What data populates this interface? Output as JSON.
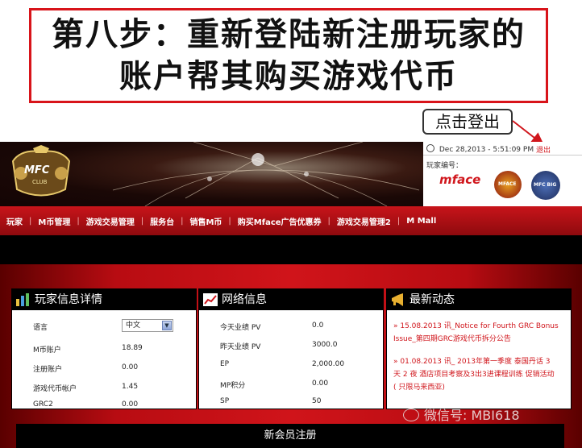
{
  "instruction": {
    "line1": "第八步：重新登陆新注册玩家的",
    "line2": "账户帮其购买游戏代币",
    "callout": "点击登出"
  },
  "site": {
    "logo": {
      "main": "MFC",
      "sub": "CLUB"
    },
    "info": {
      "datetime": "Dec 28,2013 - 5:51:09 PM",
      "logout": "退出",
      "player_id_label": "玩家编号："
    },
    "brands": {
      "mface": "mface",
      "badge2": "MFACE",
      "badge3": "MFC BIG"
    },
    "nav": [
      "玩家",
      "M币管理",
      "游戏交易管理",
      "服务台",
      "销售M币",
      "购买Mface广告优惠券",
      "游戏交易管理2",
      "M Mall"
    ],
    "panels": {
      "player": {
        "title": "玩家信息详情",
        "language_label": "语言",
        "language_value": "中文",
        "rows": [
          {
            "label": "M币账户",
            "value": "18.89"
          },
          {
            "label": "注册账户",
            "value": "0.00"
          },
          {
            "label": "游戏代币帐户",
            "value": "1.45"
          },
          {
            "label": "GRC2",
            "value": "0.00"
          }
        ]
      },
      "network": {
        "title": "网络信息",
        "rows": [
          {
            "label": "今天业绩 PV",
            "value": "0.0"
          },
          {
            "label": "昨天业绩 PV",
            "value": "3000.0"
          },
          {
            "label": "EP",
            "value": "2,000.00"
          },
          {
            "label": "MP积分",
            "value": "0.00"
          },
          {
            "label": "SP",
            "value": "50"
          }
        ]
      },
      "news": {
        "title": "最新动态",
        "item1_line1": "» 15.08.2013 讯_Notice for Fourth GRC Bonus",
        "item1_line2": "Issue_第四期GRC游戏代币拆分公告",
        "item2_line1": "» 01.08.2013 讯_ 2013年第一季度 泰国丹话 3",
        "item2_line2": "天 2 夜 酒店项目考察及3出3进课程训练 促销活动",
        "item2_line3": "( 只限马来西亚)"
      }
    },
    "register": "新会员注册",
    "watermark": "微信号: MBI618"
  },
  "colors": {
    "accent": "#d0161c",
    "nav": "#c8141a",
    "panel_head": "#000000"
  }
}
